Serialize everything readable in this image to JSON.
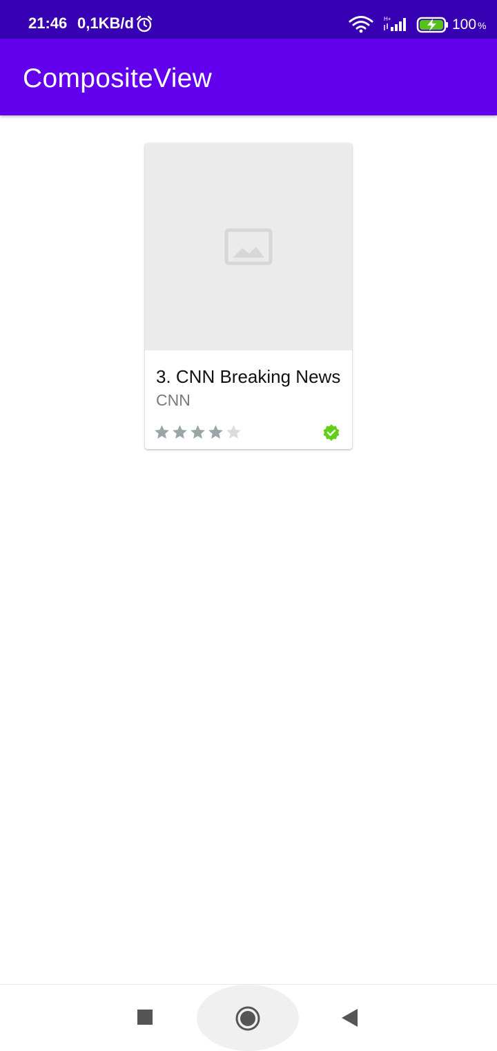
{
  "status_bar": {
    "time": "21:46",
    "data_rate": "0,1KB/d",
    "battery_percent": "100",
    "battery_percent_sign": "%",
    "icons": [
      "alarm-icon",
      "wifi-icon",
      "signal-icon",
      "battery-charging-icon"
    ]
  },
  "app_bar": {
    "title": "CompositeView",
    "color": "#6200ee"
  },
  "card": {
    "image_icon": "image-placeholder-icon",
    "title": "3. CNN Breaking News",
    "subtitle": "CNN",
    "rating": 4,
    "rating_max": 5,
    "verified_icon": "verified-check-icon",
    "verified_color": "#5fd017"
  },
  "nav_bar": {
    "buttons": [
      "recents-button",
      "home-button",
      "back-button"
    ]
  }
}
